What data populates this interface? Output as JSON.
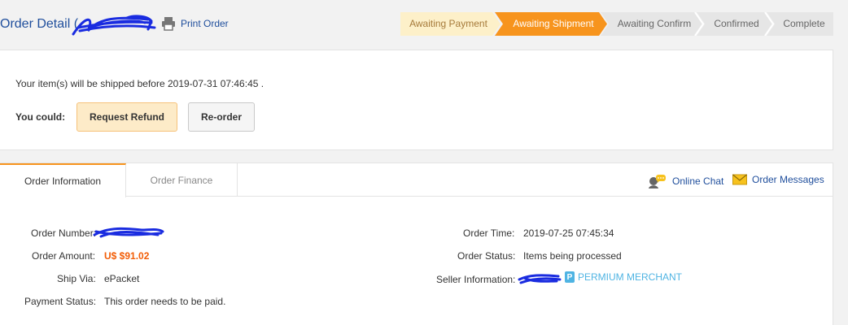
{
  "header": {
    "title": "Order Detail (",
    "title_close": ")",
    "print_label": "Print Order"
  },
  "steps": [
    {
      "label": "Awaiting Payment",
      "state": "done"
    },
    {
      "label": "Awaiting Shipment",
      "state": "current"
    },
    {
      "label": "Awaiting Confirm",
      "state": "pending"
    },
    {
      "label": "Confirmed",
      "state": "pending"
    },
    {
      "label": "Complete",
      "state": "pending"
    }
  ],
  "notice": {
    "ship_text": "Your item(s) will be shipped before 2019-07-31 07:46:45 .",
    "could_label": "You could:",
    "refund_label": "Request Refund",
    "reorder_label": "Re-order"
  },
  "tabs": {
    "active": "Order Information",
    "inactive": "Order Finance",
    "chat_label": "Online Chat",
    "messages_label": "Order Messages"
  },
  "order": {
    "number_label": "Order Number:",
    "amount_label": "Order Amount:",
    "amount_value": "U$ $91.02",
    "ship_label": "Ship Via:",
    "ship_value": "ePacket",
    "payment_label": "Payment Status:",
    "payment_value": "This order needs to be paid.",
    "time_label": "Order Time:",
    "time_value": "2019-07-25 07:45:34",
    "status_label": "Order Status:",
    "status_value": "Items being processed",
    "seller_label": "Seller Information:",
    "merchant_label": "PERMIUM MERCHANT"
  },
  "colors": {
    "brand_blue": "#1f4e9c",
    "accent_orange": "#f7941d",
    "amount_orange": "#f25c05",
    "merchant_blue": "#4fb4e3"
  }
}
